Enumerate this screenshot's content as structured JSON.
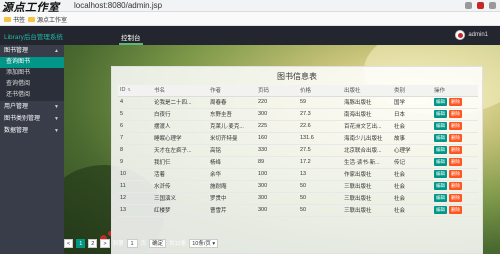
{
  "browser": {
    "watermark": "源点工作室",
    "url": "localhost:8080/admin.jsp"
  },
  "bookmarks": [
    {
      "label": "书签"
    },
    {
      "label": "源点工作室"
    }
  ],
  "app": {
    "brand": "Library后台管理系统",
    "tab": "控制台",
    "user": "admin1"
  },
  "sidebar": {
    "groups": [
      {
        "label": "图书管理",
        "caret": "▲",
        "items": [
          {
            "label": "查询图书",
            "active": true
          },
          {
            "label": "添加图书"
          },
          {
            "label": "查询借阅"
          },
          {
            "label": "还书借阅"
          }
        ]
      },
      {
        "label": "用户管理",
        "caret": "▼"
      },
      {
        "label": "图书类别管理",
        "caret": "▼"
      },
      {
        "label": "数据管理",
        "caret": "▼"
      }
    ]
  },
  "panel": {
    "title": "图书信息表",
    "columns": [
      "ID",
      "书名",
      "作者",
      "页码",
      "价格",
      "出版社",
      "类别",
      "操作"
    ],
    "edit_label": "编辑",
    "delete_label": "删除",
    "rows": [
      [
        "4",
        "论我是二十四...",
        "周春春",
        "220",
        "59",
        "海豚出版社",
        "国学"
      ],
      [
        "5",
        "白夜行",
        "东野圭吾",
        "300",
        "27.3",
        "南海出版社",
        "日本"
      ],
      [
        "6",
        "摆渡人",
        "克莱儿·麦克...",
        "225",
        "22.6",
        "百花洲文艺出...",
        "社会"
      ],
      [
        "7",
        "睡眠心理学",
        "米切齐特曼",
        "160",
        "131.6",
        "海南少儿出版社",
        "故事"
      ],
      [
        "8",
        "天才在左疯子...",
        "高铭",
        "330",
        "27.5",
        "北京联合出版...",
        "心理学"
      ],
      [
        "9",
        "我们仨",
        "杨绛",
        "89",
        "17.2",
        "生活·读书·新...",
        "传记"
      ],
      [
        "10",
        "活着",
        "余华",
        "100",
        "13",
        "作家出版社",
        "社会"
      ],
      [
        "11",
        "水浒传",
        "施耐庵",
        "300",
        "50",
        "三联出版社",
        "社会"
      ],
      [
        "12",
        "三国演义",
        "罗贯中",
        "300",
        "50",
        "三联出版社",
        "社会"
      ],
      [
        "13",
        "红楼梦",
        "曹雪芹",
        "300",
        "50",
        "三联出版社",
        "社会"
      ]
    ]
  },
  "pager": {
    "prev": "<",
    "current": "1",
    "next_page": "2",
    "next": ">",
    "goto_label": "到第",
    "goto_value": "1",
    "page_unit": "页",
    "confirm": "确定",
    "total": "共12条",
    "per_page": "10条/页"
  }
}
